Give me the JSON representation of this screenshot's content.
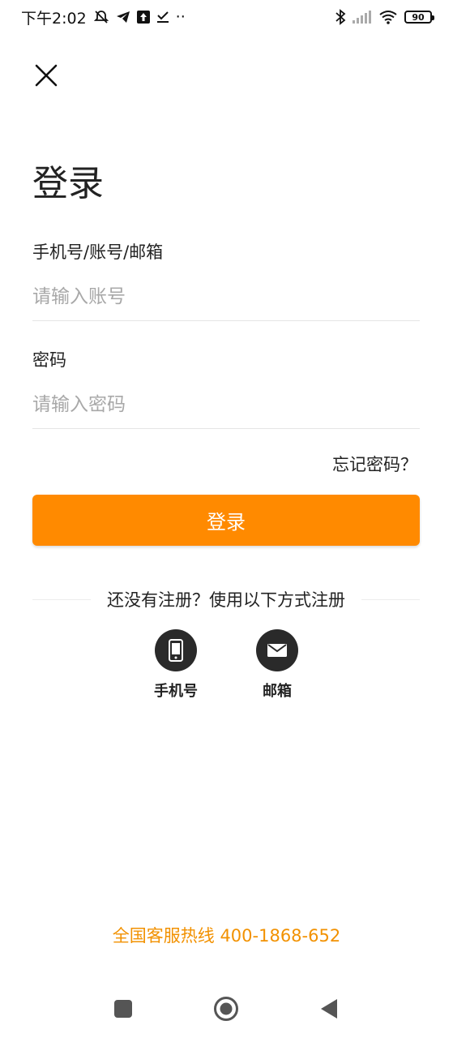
{
  "status_bar": {
    "time": "下午2:02",
    "battery": "90",
    "more": "··"
  },
  "page": {
    "title": "登录"
  },
  "account": {
    "label": "手机号/账号/邮箱",
    "placeholder": "请输入账号",
    "value": ""
  },
  "password": {
    "label": "密码",
    "placeholder": "请输入密码",
    "value": ""
  },
  "forgot_label": "忘记密码？",
  "login_button_label": "登录",
  "register": {
    "prompt": "还没有注册？使用以下方式注册",
    "options": [
      {
        "label": "手机号",
        "icon": "phone-icon"
      },
      {
        "label": "邮箱",
        "icon": "mail-icon"
      }
    ]
  },
  "hotline": "全国客服热线 400-1868-652",
  "colors": {
    "accent": "#ff8a00",
    "hotline": "#f29100",
    "icon_circle": "#2a2a2a"
  }
}
